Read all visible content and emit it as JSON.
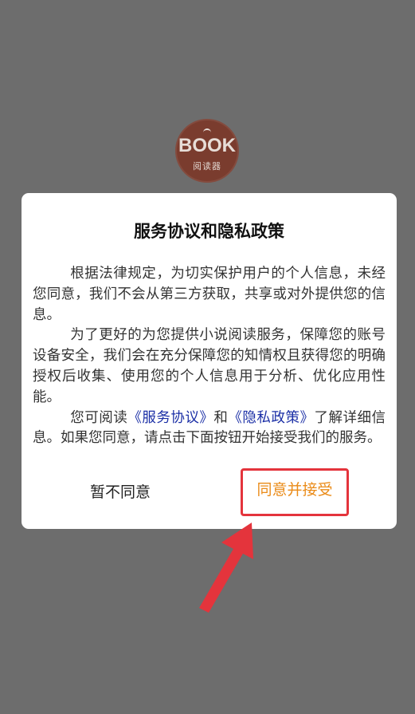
{
  "logo": {
    "text": "BOOK",
    "subtitle": "阅读器"
  },
  "dialog": {
    "title": "服务协议和隐私政策",
    "paragraph1": "根据法律规定，为切实保护用户的个人信息，未经您同意，我们不会从第三方获取，共享或对外提供您的信息。",
    "paragraph2": "为了更好的为您提供小说阅读服务，保障您的账号设备安全，我们会在充分保障您的知情权且获得您的明确授权后收集、使用您的个人信息用于分析、优化应用性能。",
    "paragraph3_prefix": "您可阅读",
    "service_link": "《服务协议》",
    "paragraph3_and": "和",
    "privacy_link": "《隐私政策》",
    "paragraph3_suffix": "了解详细信息。如果您同意，请点击下面按钮开始接受我们的服务。",
    "decline_label": "暂不同意",
    "accept_label": "同意并接受"
  },
  "colors": {
    "overlay": "#6d6d6d",
    "accept": "#ea8b18",
    "link": "#1b2fa6",
    "annotation": "#e4343c"
  }
}
